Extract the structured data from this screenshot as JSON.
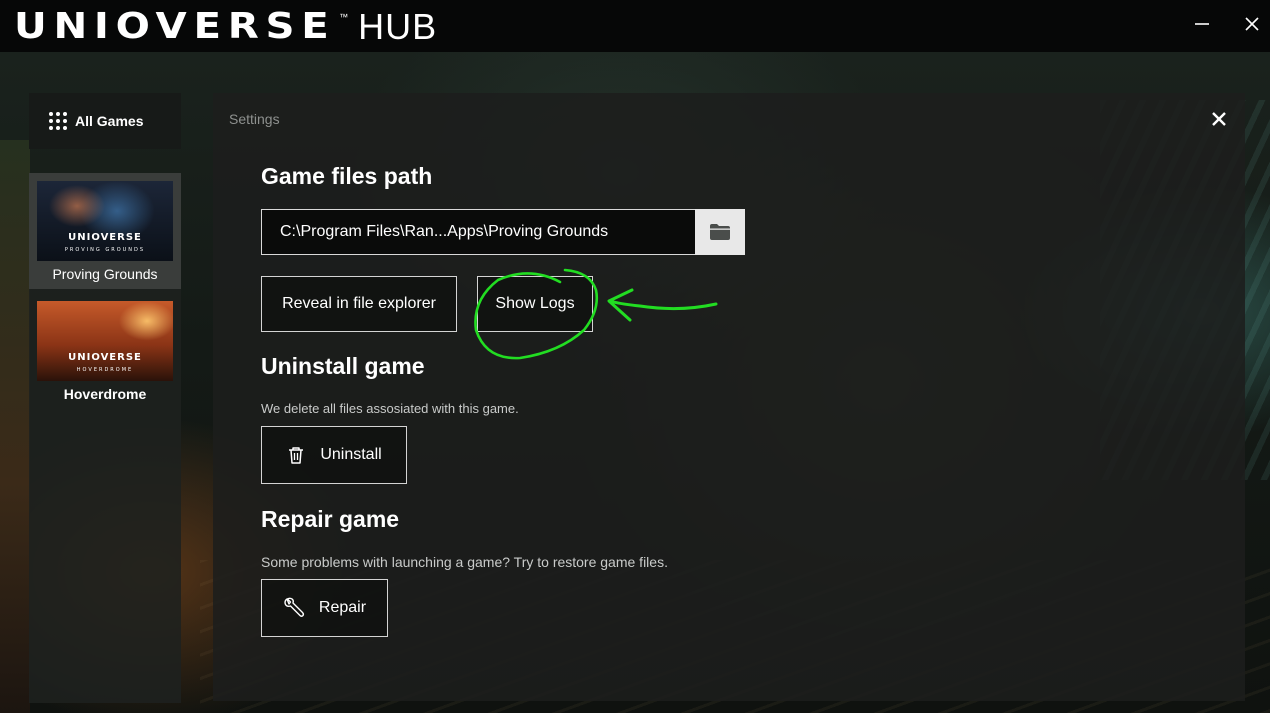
{
  "titlebar": {
    "brand": "UNIOVERSE",
    "trademark": "™",
    "hub": "HUB",
    "minimize_icon": "minimize-icon",
    "close_icon": "close-icon"
  },
  "sidebar": {
    "all_games_label": "All Games",
    "all_games_icon": "grid-dots-icon",
    "games": [
      {
        "title": "Proving Grounds",
        "logo": "UNIOVERSE",
        "logo_sub": "PROVING GROUNDS",
        "active": true
      },
      {
        "title": "Hoverdrome",
        "logo": "UNIOVERSE",
        "logo_sub": "HOVERDROME",
        "active": false
      }
    ]
  },
  "settings": {
    "title": "Settings",
    "close_icon": "close-icon",
    "game_files": {
      "heading": "Game files path",
      "path_value": "C:\\Program Files\\Ran...Apps\\Proving Grounds",
      "browse_icon": "folder-icon",
      "reveal_label": "Reveal in file explorer",
      "logs_label": "Show Logs"
    },
    "uninstall": {
      "heading": "Uninstall game",
      "description": "We delete all files assosiated with this game.",
      "button_label": "Uninstall",
      "icon": "trash-icon"
    },
    "repair": {
      "heading": "Repair game",
      "description": "Some problems with launching a game? Try to restore game files.",
      "button_label": "Repair",
      "icon": "wrench-icon"
    }
  },
  "annotation": {
    "color": "#22dd22",
    "shape": "circle-and-arrow"
  }
}
